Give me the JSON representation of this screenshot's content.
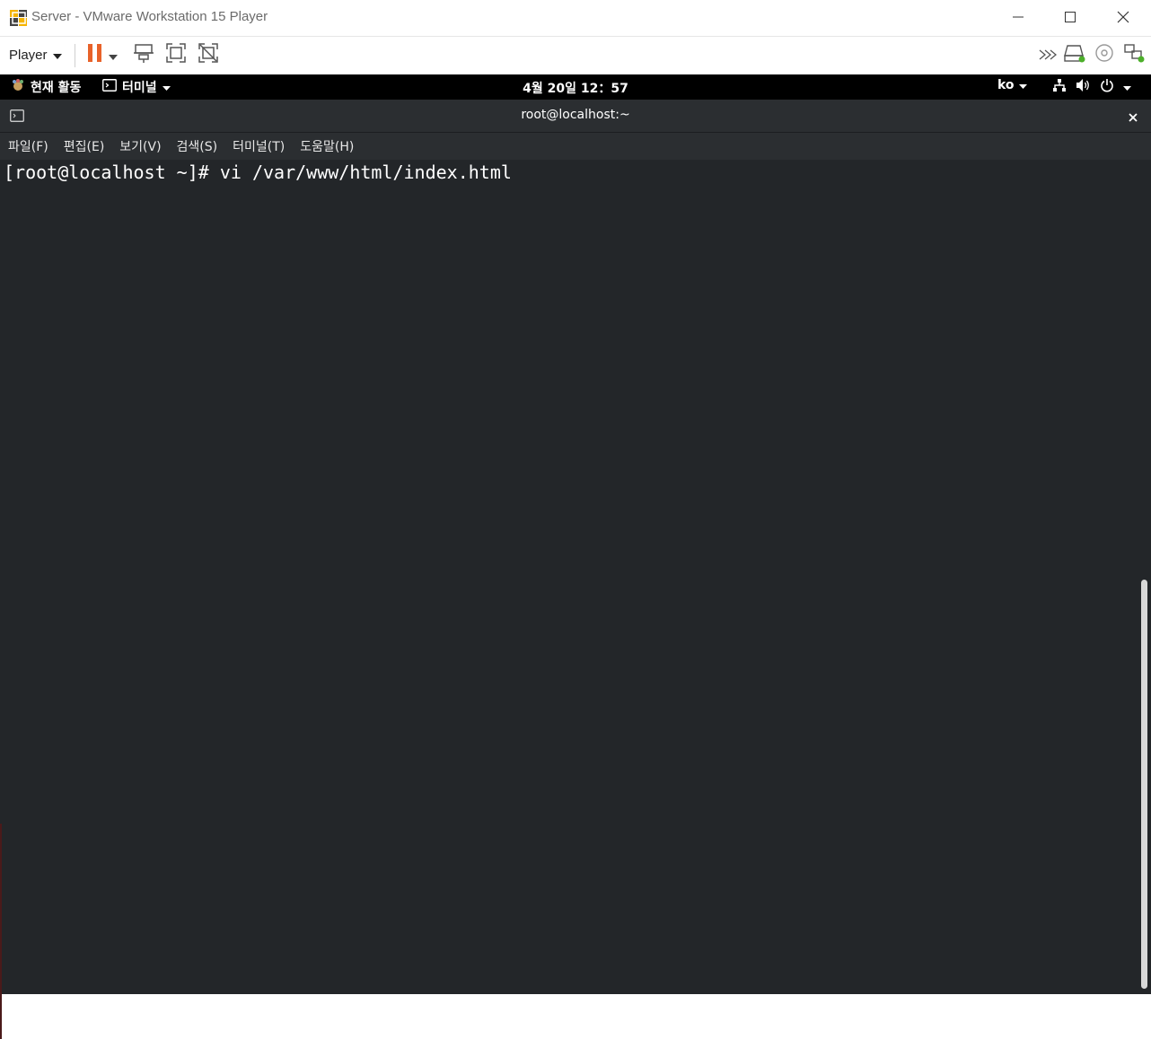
{
  "window": {
    "title": "Server - VMware Workstation 15 Player",
    "icons": {
      "app": "vmware-logo-icon",
      "minimize": "minimize-icon",
      "maximize": "maximize-icon",
      "close": "close-icon"
    }
  },
  "toolbar": {
    "player_label": "Player",
    "buttons": [
      "pause-icon",
      "send-ctrl-alt-del-icon",
      "full-screen-icon",
      "unity-icon"
    ],
    "right_icons": [
      "more-icon",
      "hard-disk-icon",
      "cd-dvd-icon",
      "network-adapter-icon"
    ]
  },
  "gnome": {
    "activities": "현재 활동",
    "app_menu": "터미널",
    "clock": "4월 20일  12：57",
    "language": "ko"
  },
  "terminal": {
    "title": "root@localhost:~",
    "menu": [
      "파일(F)",
      "편집(E)",
      "보기(V)",
      "검색(S)",
      "터미널(T)",
      "도움말(H)"
    ],
    "lines": [
      "[root@localhost ~]# vi /var/www/html/index.html"
    ]
  },
  "colors": {
    "pause": "#e8622a",
    "terminal_bg": "#232629",
    "header_bg": "#2b2e31",
    "gnome_bar": "#000000"
  }
}
